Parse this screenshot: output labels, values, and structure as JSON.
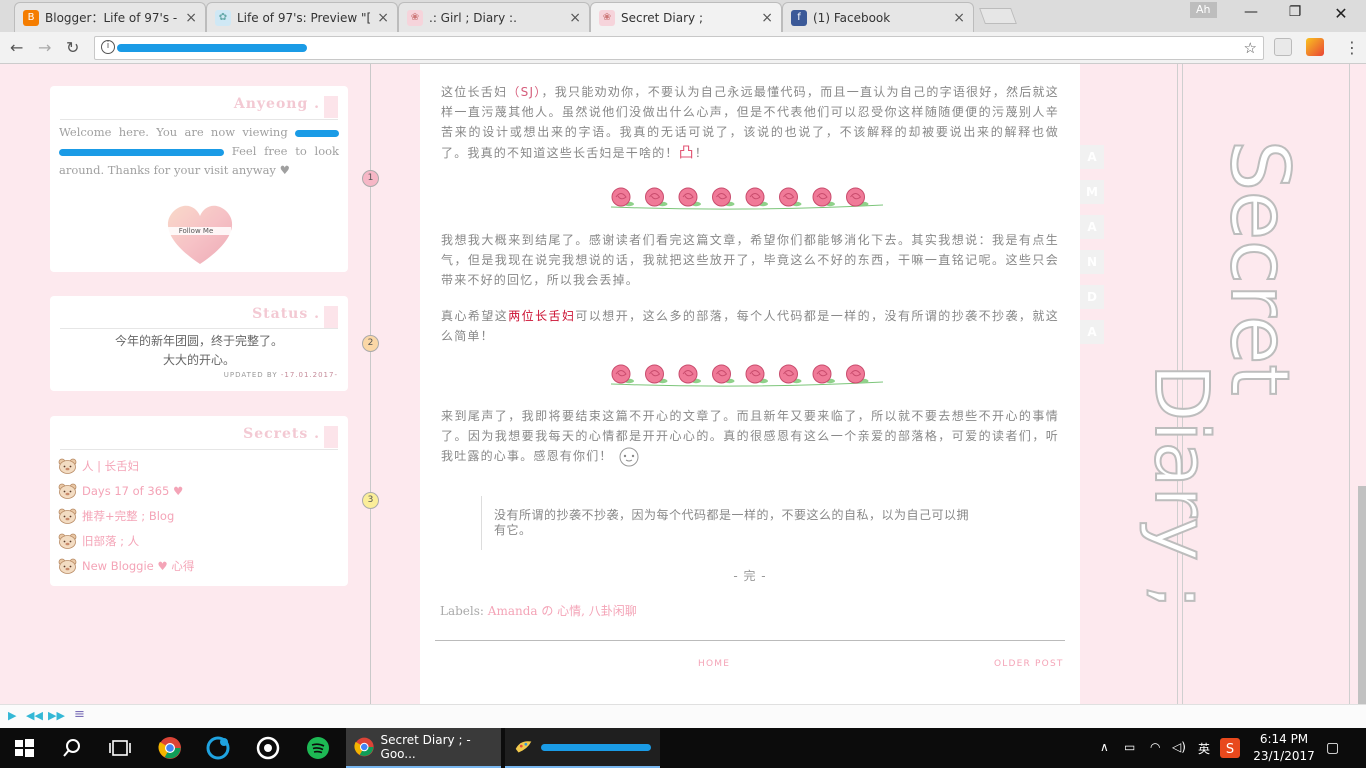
{
  "browser": {
    "tabs": [
      {
        "title": "Blogger：Life of 97's - 仓",
        "icon": "blogger-icon"
      },
      {
        "title": "Life of 97's: Preview \"[友",
        "icon": "blog-favicon"
      },
      {
        "title": ".: Girl ; Diary :.",
        "icon": "blog-favicon"
      },
      {
        "title": "Secret Diary ;",
        "icon": "blog-favicon"
      },
      {
        "title": "(1) Facebook",
        "icon": "facebook-icon"
      }
    ],
    "profile_label": "Ah",
    "address_icon": "info-icon"
  },
  "sidebar": {
    "anyeong_title": "Anyeong .",
    "welcome_before": "Welcome here. You are now viewing",
    "welcome_after": "Feel free to look around. Thanks for your visit anyway ♥",
    "follow_label": "Follow Me",
    "status_title": "Status .",
    "status_line1": "今年的新年团圆，终于完整了。",
    "status_line2": "大大的开心。",
    "updated_label": "UPDATED BY",
    "updated_date": "-17.01.2017-",
    "secrets_title": "Secrets .",
    "secrets": [
      "人 | 长舌妇",
      "Days 17 of 365 ♥",
      "推荐+完整 ; Blog",
      "旧部落 ; 人",
      "New Bloggie ♥ 心得"
    ]
  },
  "bubbles": [
    "1",
    "2",
    "3"
  ],
  "post": {
    "p1_a": "这位长舌妇",
    "p1_hl": "（SJ）",
    "p1_b": "，我只能劝劝你，不要认为自己永远最懂代码，而且一直认为自己的字语很好，然后就这样一直污蔑其他人。虽然说他们没做出什么心声，但是不代表他们可以忍受你这样随随便便的污蔑别人辛苦来的设计或想出来的字语。我真的无话可说了，该说的也说了，不该解释的却被要说出来的解释也做了。我真的不知道这些长舌妇是干啥的！",
    "p1_icon": "凸",
    "p1_end": "！",
    "p2": "我想我大概来到结尾了。感谢读者们看完这篇文章，希望你们都能够消化下去。其实我想说：我是有点生气，但是我现在说完我想说的话，我就把这些放开了，毕竟这么不好的东西，干嘛一直铭记呢。这些只会带来不好的回忆，所以我会丢掉。",
    "p3_a": "真心希望这",
    "p3_red": "两位长舌妇",
    "p3_b": "可以想开，这么多的部落，每个人代码都是一样的，没有所谓的抄袭不抄袭，就这么简单！",
    "p4": "来到尾声了，我即将要结束这篇不开心的文章了。而且新年又要来临了，所以就不要去想些不开心的事情了。因为我想要我每天的心情都是开开心心的。真的很感恩有这么一个亲爱的部落格，可爱的读者们，听我吐露的心事。感恩有你们！",
    "quote": "没有所谓的抄袭不抄袭，因为每个代码都是一样的，不要这么的自私，以为自己可以拥有它。",
    "end_mark": "- 完 -",
    "labels_prefix": "Labels:",
    "labels_text": "Amanda の 心情, 八卦闲聊",
    "home_link": "HOME",
    "older_link": "OLDER POST"
  },
  "right": {
    "letters": [
      "A",
      "M",
      "A",
      "N",
      "D",
      "A"
    ],
    "script1": "Secret",
    "script2": "Diary ;"
  },
  "taskbar": {
    "active_app": "Secret Diary ; - Goo...",
    "time": "6:14 PM",
    "date": "23/1/2017",
    "ime": "英"
  },
  "colors": {
    "accent_pink": "#f4a4b7",
    "bg_pink": "#fde9ee",
    "highlight_red": "#cc1133"
  }
}
